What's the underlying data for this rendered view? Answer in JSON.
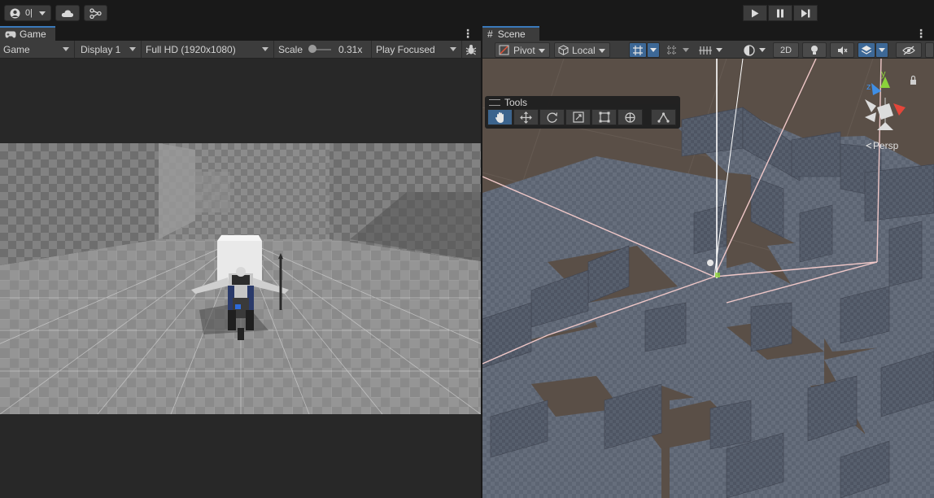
{
  "topbar": {
    "account_label": "0|",
    "icons": [
      "account-icon",
      "cloud-icon",
      "collab-icon",
      "play-icon",
      "pause-icon",
      "step-icon"
    ]
  },
  "game": {
    "tab_label": "Game",
    "view_dropdown": "Game",
    "display_dropdown": "Display 1",
    "resolution_dropdown": "Full HD (1920x1080)",
    "scale_label": "Scale",
    "scale_value_text": "0.31x",
    "scale_level": 0.0,
    "play_mode_dropdown": "Play Focused"
  },
  "scene": {
    "tab_label": "Scene",
    "pivot_label": "Pivot",
    "local_label": "Local",
    "mode_2d_label": "2D",
    "tools_title": "Tools",
    "persp_label": "Persp",
    "gizmo_axes": {
      "y": "y",
      "z": "z"
    }
  },
  "colors": {
    "accent": "#3a79bb",
    "panel_bg": "#282828",
    "toolbar_bg": "#3c3c3c",
    "scene_ground": "#5a4f47",
    "gizmo_y": "#8bd23a",
    "gizmo_x": "#e4463a",
    "gizmo_z": "#3f8fe6"
  }
}
